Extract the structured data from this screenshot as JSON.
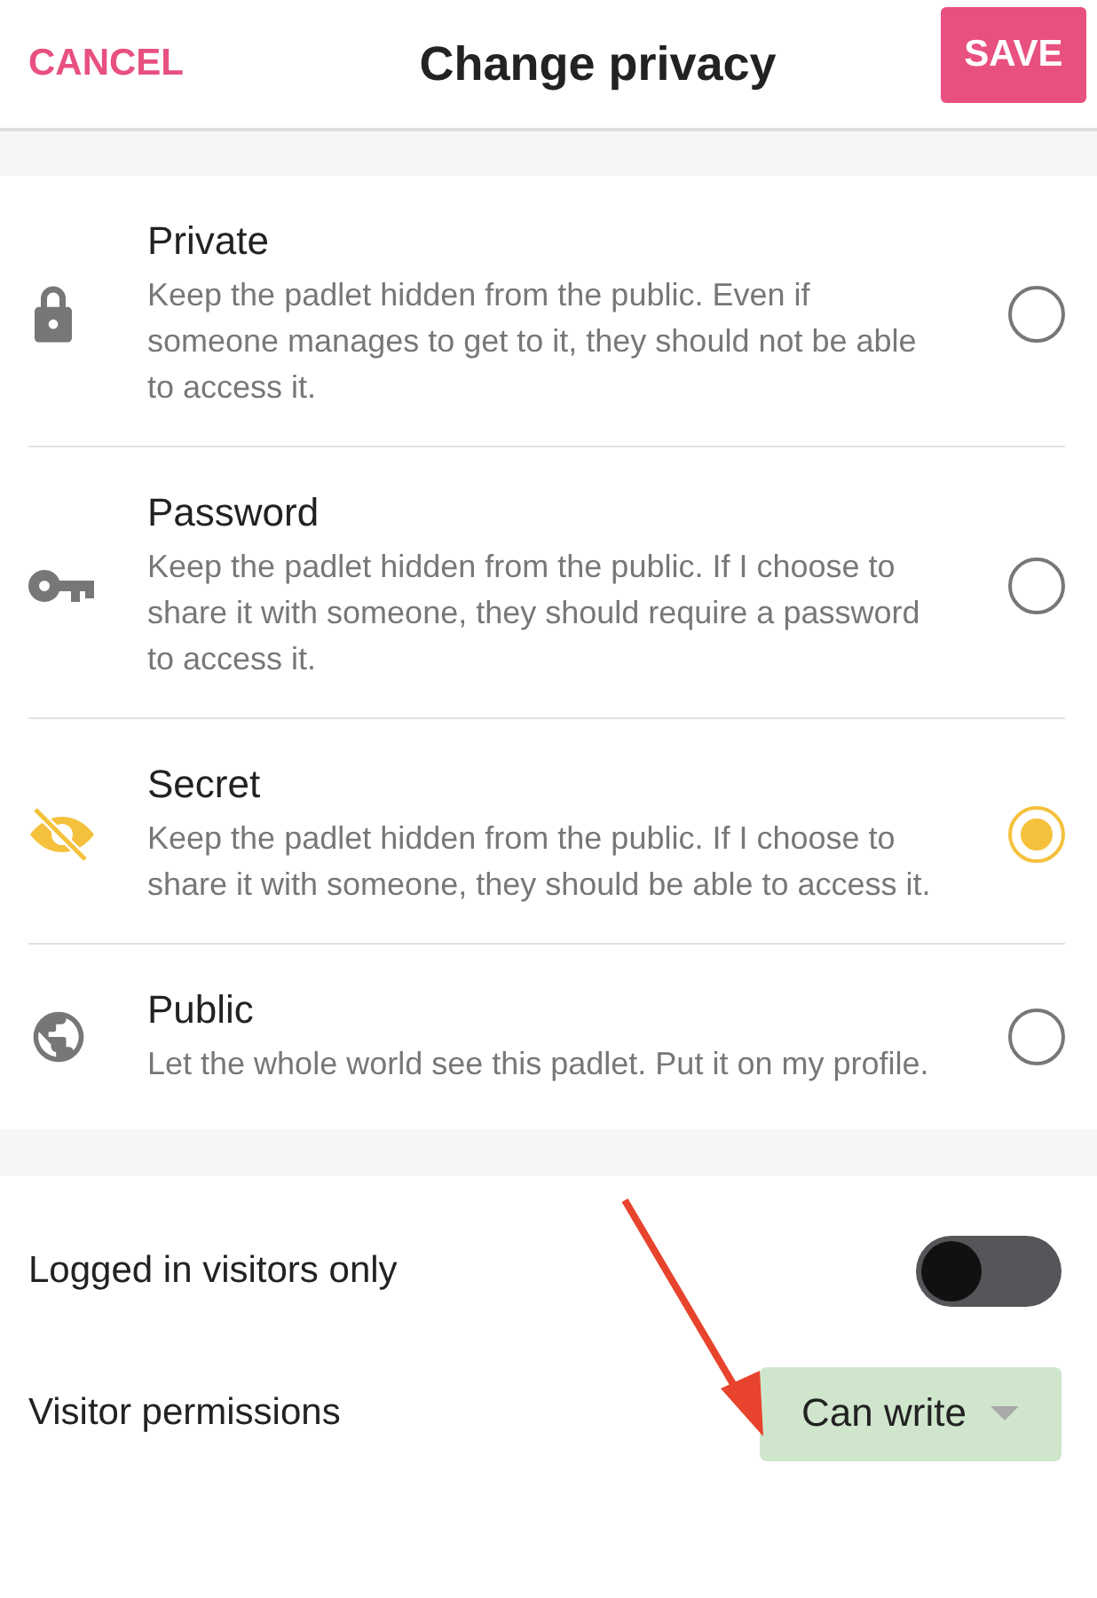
{
  "header": {
    "cancel": "CANCEL",
    "title": "Change privacy",
    "save": "SAVE"
  },
  "options": [
    {
      "kind": "private",
      "title": "Private",
      "description": "Keep the padlet hidden from the public. Even if someone manages to get to it, they should not be able to access it.",
      "selected": false
    },
    {
      "kind": "password",
      "title": "Password",
      "description": "Keep the padlet hidden from the public. If I choose to share it with someone, they should require a password to access it.",
      "selected": false
    },
    {
      "kind": "secret",
      "title": "Secret",
      "description": "Keep the padlet hidden from the public. If I choose to share it with someone, they should be able to access it.",
      "selected": true
    },
    {
      "kind": "public",
      "title": "Public",
      "description": "Let the whole world see this padlet. Put it on my profile.",
      "selected": false
    }
  ],
  "settings": [
    {
      "kind": "toggle",
      "label": "Logged in visitors only",
      "on": false
    },
    {
      "kind": "dropdown",
      "label": "Visitor permissions",
      "value": "Can write"
    }
  ],
  "annotation": {
    "kind": "arrow"
  }
}
